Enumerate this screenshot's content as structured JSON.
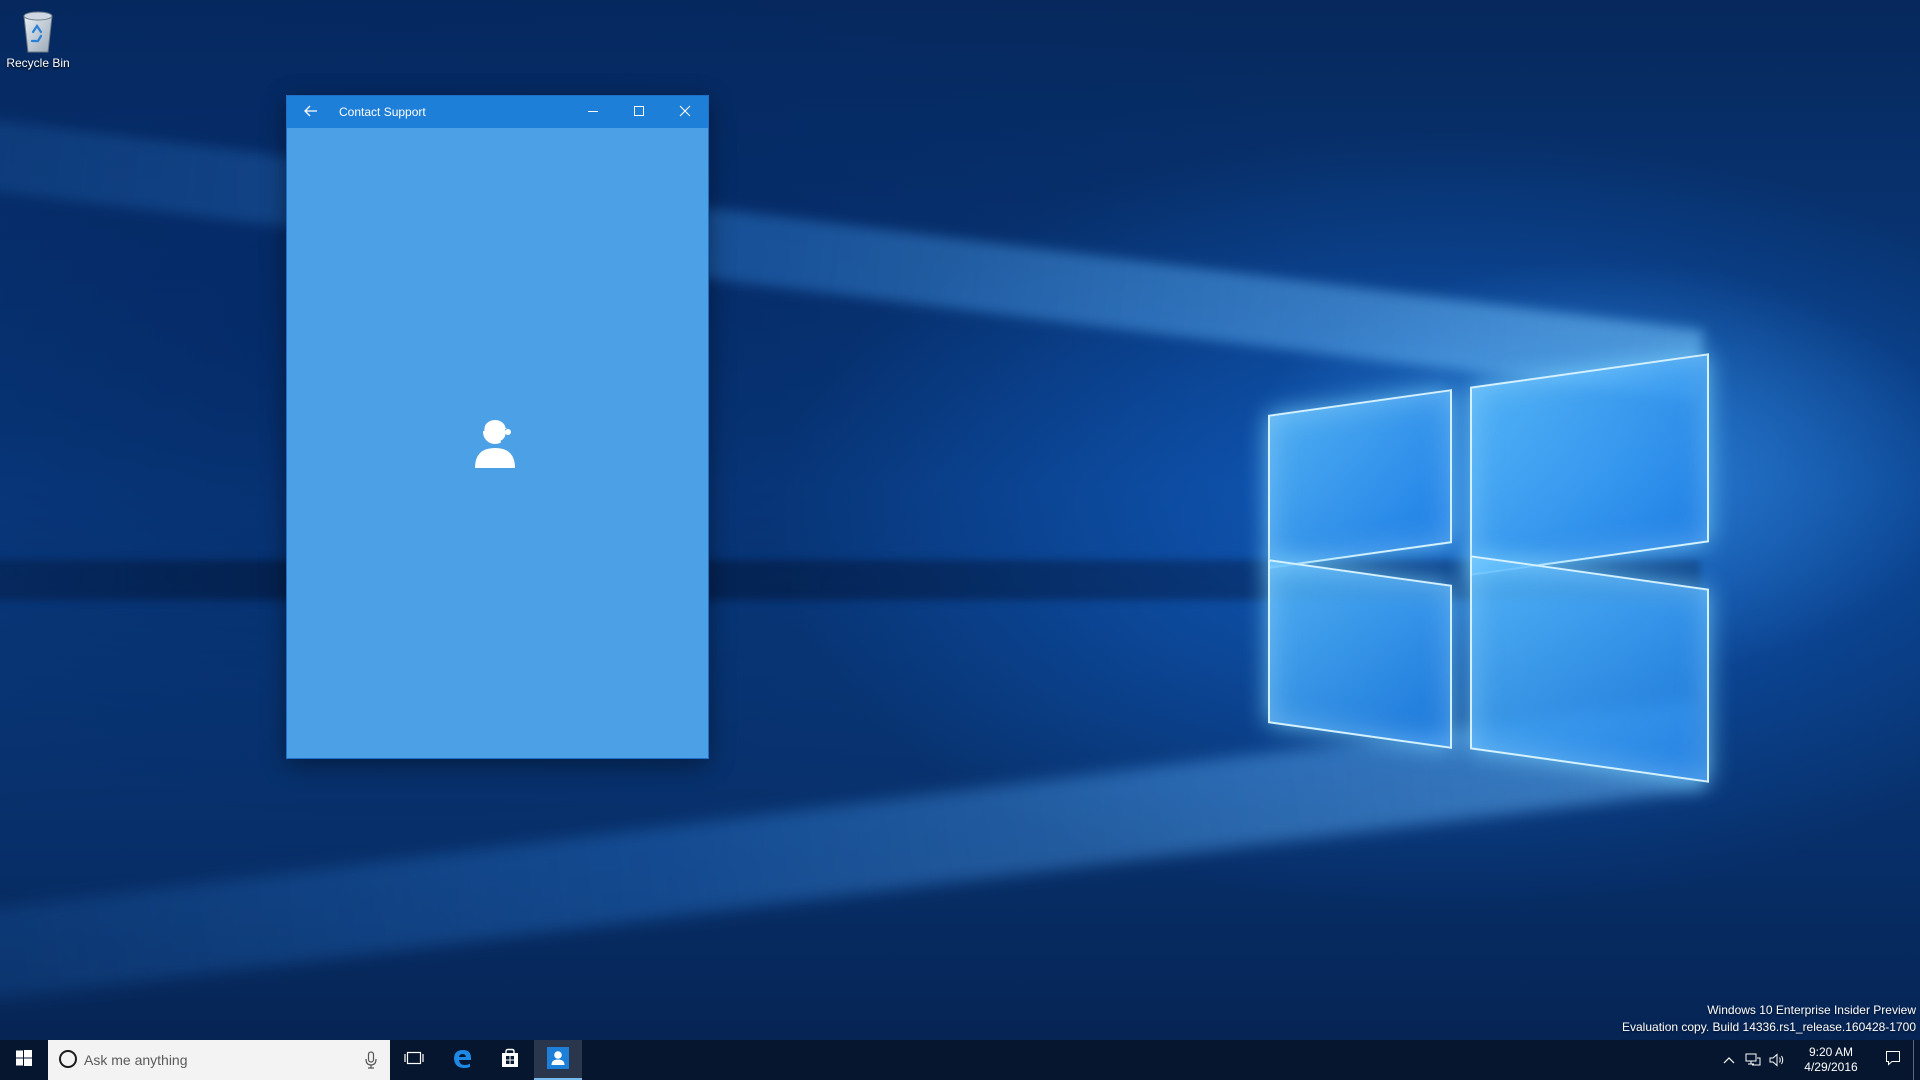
{
  "desktop": {
    "icons": [
      {
        "label": "Recycle Bin",
        "icon": "recycle-bin-icon"
      }
    ]
  },
  "window": {
    "title": "Contact Support",
    "back_icon": "back-arrow-icon",
    "minimize_icon": "minimize-icon",
    "maximize_icon": "maximize-icon",
    "close_icon": "close-icon",
    "content_icon": "support-agent-icon",
    "colors": {
      "titlebar": "#1d7fd8",
      "body": "#4ca1e6"
    }
  },
  "watermark": {
    "line1": "Windows 10 Enterprise Insider Preview",
    "line2": "Evaluation copy. Build 14336.rs1_release.160428-1700"
  },
  "taskbar": {
    "start_icon": "windows-start-icon",
    "search_placeholder": "Ask me anything",
    "apps": [
      {
        "name": "Task View",
        "icon": "task-view-icon",
        "active": false
      },
      {
        "name": "Microsoft Edge",
        "icon": "edge-icon",
        "active": false
      },
      {
        "name": "Store",
        "icon": "store-icon",
        "active": false
      },
      {
        "name": "Contact Support",
        "icon": "contact-support-icon",
        "active": true
      }
    ],
    "clock": {
      "time": "9:20 AM",
      "date": "4/29/2016"
    },
    "tray_icons": [
      "show-hidden-icons-chevron",
      "network-icon",
      "volume-icon"
    ]
  }
}
